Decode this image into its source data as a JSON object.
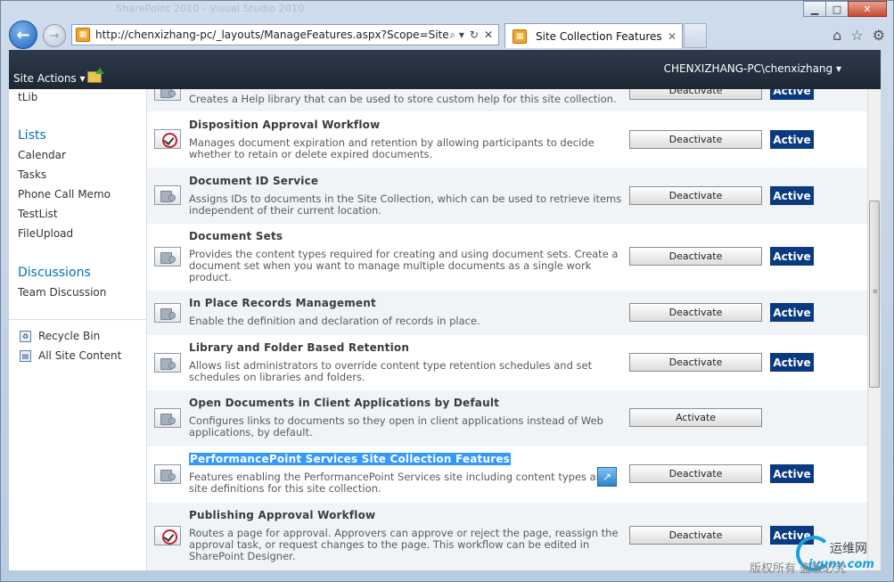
{
  "browser": {
    "window_title": "SharePoint 2010 - Visual Studio 2010",
    "url": "http://chenxizhang-pc/_layouts/ManageFeatures.aspx?Scope=Site",
    "tab_label": "Site Collection Features",
    "win_minimize": "▁",
    "win_maximize": "□",
    "win_close": "✕",
    "addr_tools": [
      "⌕ ▾",
      "↻",
      "✕"
    ],
    "nav_icons": [
      "⌂",
      "☆",
      "⚙"
    ]
  },
  "sp_top": {
    "site_actions": "Site Actions ▾",
    "user": "CHENXIZHANG-PC\\chenxizhang ▾"
  },
  "sidebar": {
    "partial_item": "tLib",
    "lists_header": "Lists",
    "lists": [
      "Calendar",
      "Tasks",
      "Phone Call Memo",
      "TestList",
      "FileUpload"
    ],
    "discussions_header": "Discussions",
    "discussions": [
      "Team Discussion"
    ],
    "recycle_bin": "Recycle Bin",
    "all_site_content": "All Site Content"
  },
  "features": [
    {
      "title": "",
      "desc": "Creates a Help library that can be used to store custom help for this site collection.",
      "button": "Deactivate",
      "status": "Active",
      "icon": "puzzle-icon"
    },
    {
      "title": "Disposition Approval Workflow",
      "desc": "Manages document expiration and retention by allowing participants to decide whether to retain or delete expired documents.",
      "button": "Deactivate",
      "status": "Active",
      "icon": "workflow-icon"
    },
    {
      "title": "Document ID Service",
      "desc": "Assigns IDs to documents in the Site Collection, which can be used to retrieve items independent of their current location.",
      "button": "Deactivate",
      "status": "Active",
      "icon": "puzzle-icon"
    },
    {
      "title": "Document Sets",
      "desc": "Provides the content types required for creating and using document sets. Create a document set when you want to manage multiple documents as a single work product.",
      "button": "Deactivate",
      "status": "Active",
      "icon": "puzzle-icon"
    },
    {
      "title": "In Place Records Management",
      "desc": "Enable the definition and declaration of records in place.",
      "button": "Deactivate",
      "status": "Active",
      "icon": "puzzle-icon"
    },
    {
      "title": "Library and Folder Based Retention",
      "desc": "Allows list administrators to override content type retention schedules and set schedules on libraries and folders.",
      "button": "Deactivate",
      "status": "Active",
      "icon": "puzzle-icon"
    },
    {
      "title": "Open Documents in Client Applications by Default",
      "desc": "Configures links to documents so they open in client applications instead of Web applications, by default.",
      "button": "Activate",
      "status": "",
      "icon": "puzzle-icon"
    },
    {
      "title": "PerformancePoint Services Site Collection Features",
      "desc": "Features enabling the PerformancePoint Services site including content types and site definitions for this site collection.",
      "button": "Deactivate",
      "status": "Active",
      "icon": "puzzle-icon"
    },
    {
      "title": "Publishing Approval Workflow",
      "desc": "Routes a page for approval. Approvers can approve or reject the page, reassign the approval task, or request changes to the page. This workflow can be edited in SharePoint Designer.",
      "button": "Deactivate",
      "status": "Active",
      "icon": "workflow-icon"
    }
  ],
  "watermark": {
    "line1": "运维网",
    "line2": "iyunv.com",
    "line3": "版权所有 盗版必究"
  }
}
